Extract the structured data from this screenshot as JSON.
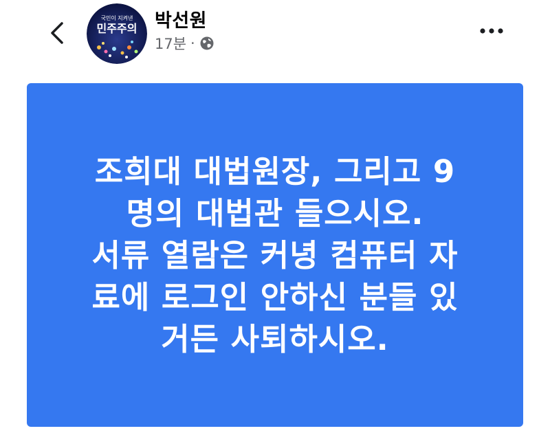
{
  "header": {
    "back_icon": "chevron-left-icon",
    "avatar": {
      "badge_text_small": "국민이 지켜낸",
      "badge_text_main": "민주주의"
    },
    "author_name": "박선원",
    "timestamp": "17분",
    "separator": "·",
    "privacy_icon": "globe-icon",
    "more_icon": "more-horizontal-icon"
  },
  "post": {
    "background_color": "#3578f0",
    "text": "조희대 대법원장, 그리고 9\n명의 대법관 들으시오.\n서류 열람은 커녕 컴퓨터 자\n료에 로그인 안하신 분들 있\n거든 사퇴하시오."
  }
}
